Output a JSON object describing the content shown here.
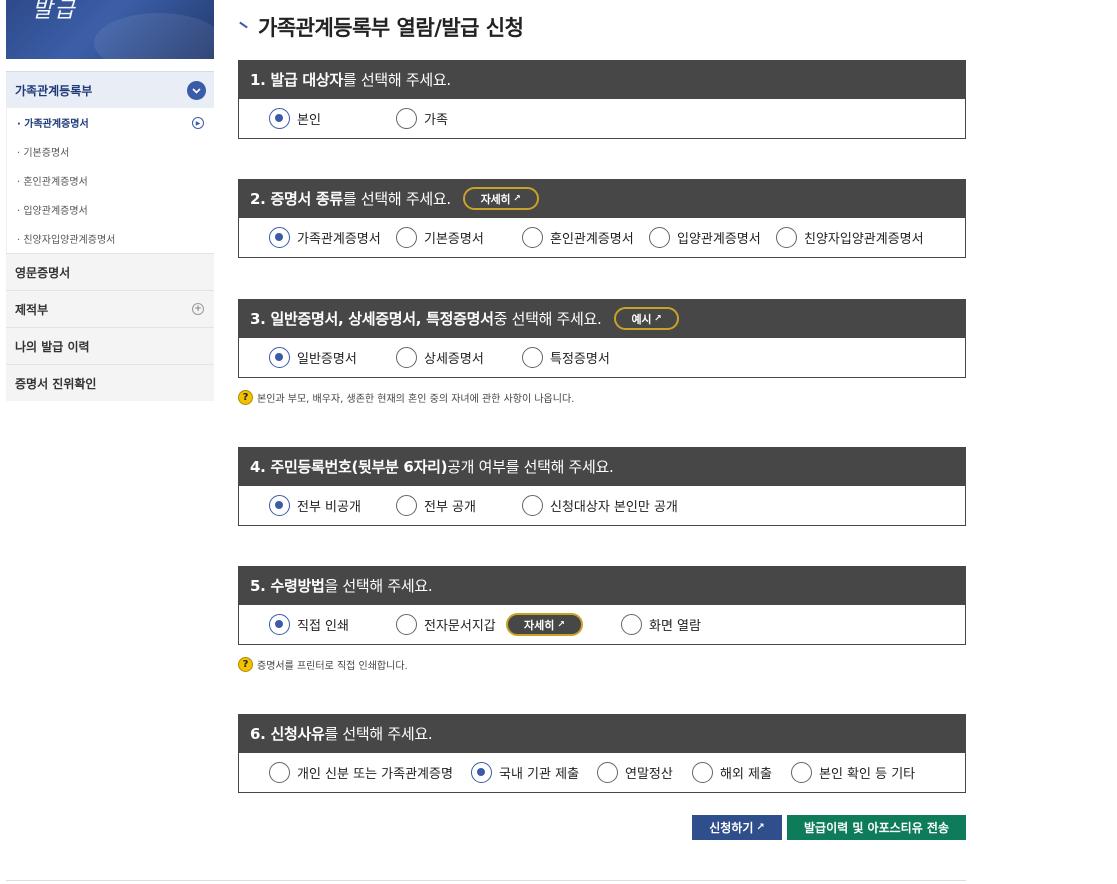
{
  "banner": {
    "text": "발급"
  },
  "sidebar": {
    "main_label": "가족관계등록부",
    "sub_items": [
      {
        "label": "· 가족관계증명서",
        "active": true
      },
      {
        "label": "· 기본증명서"
      },
      {
        "label": "· 혼인관계증명서"
      },
      {
        "label": "· 입양관계증명서"
      },
      {
        "label": "· 친양자입양관계증명서"
      }
    ],
    "sections": [
      {
        "label": "영문증명서"
      },
      {
        "label": "제적부"
      },
      {
        "label": "나의 발급 이력"
      },
      {
        "label": "증명서 진위확인"
      }
    ]
  },
  "page_title": "가족관계등록부 열람/발급 신청",
  "sections": {
    "s1": {
      "head_bold": "1. 발급 대상자",
      "head_rest": "를 선택해 주세요.",
      "options": [
        "본인",
        "가족"
      ],
      "selected": 0
    },
    "s2": {
      "head_bold": "2. 증명서 종류",
      "head_rest": "를 선택해 주세요.",
      "pill": "자세히",
      "options": [
        "가족관계증명서",
        "기본증명서",
        "혼인관계증명서",
        "입양관계증명서",
        "친양자입양관계증명서"
      ],
      "selected": 0
    },
    "s3": {
      "head_bold": "3. 일반증명서, 상세증명서, 특정증명서",
      "head_rest": " 중 선택해 주세요.",
      "pill": "예시",
      "options": [
        "일반증명서",
        "상세증명서",
        "특정증명서"
      ],
      "selected": 0,
      "note": "본인과 부모, 배우자, 생존한 현재의 혼인 중의 자녀에 관한 사항이 나옵니다."
    },
    "s4": {
      "head_bold": "4. 주민등록번호(뒷부분 6자리)",
      "head_rest": " 공개 여부를 선택해 주세요.",
      "options": [
        "전부 비공개",
        "전부 공개",
        "신청대상자 본인만 공개"
      ],
      "selected": 0
    },
    "s5": {
      "head_bold": "5. 수령방법",
      "head_rest": "을 선택해 주세요.",
      "options": [
        "직접 인쇄",
        "전자문서지갑",
        "화면 열람"
      ],
      "selected": 0,
      "pill": "자세히",
      "note": "증명서를 프린터로 직접 인쇄합니다."
    },
    "s6": {
      "head_bold": "6. 신청사유",
      "head_rest": "를 선택해 주세요.",
      "options": [
        "개인 신분 또는 가족관계증명",
        "국내 기관 제출",
        "연말정산",
        "해외 제출",
        "본인 확인 등 기타"
      ],
      "selected": 1
    }
  },
  "buttons": {
    "apply": "신청하기",
    "send": "발급이력 및 아포스티유 전송"
  },
  "icons": {
    "external": "external-link-icon",
    "question": "question-icon",
    "chevron": "chevron-down-icon"
  },
  "colors": {
    "header_bg": "#474747",
    "accent": "#3a5ba8",
    "pill_border": "#c9a227",
    "apply_btn": "#2f4e8c",
    "send_btn": "#0e7b5a"
  }
}
